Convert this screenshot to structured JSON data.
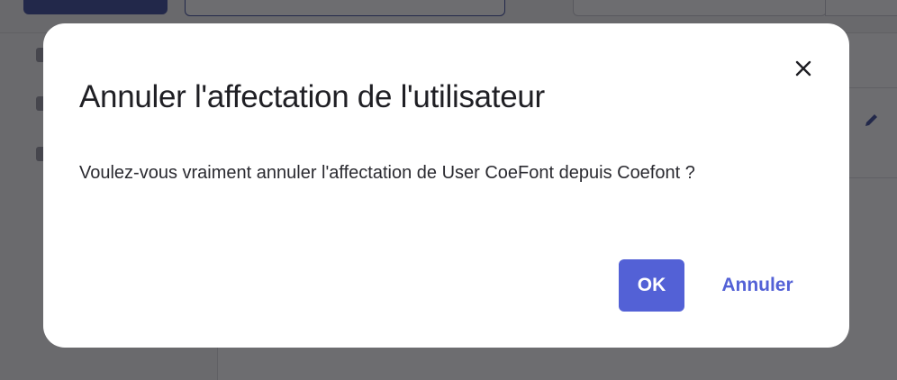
{
  "dialog": {
    "title": "Annuler l'affectation de l'utilisateur",
    "message": "Voulez-vous vraiment annuler l'affectation de User CoeFont depuis Coefont ?",
    "ok_label": "OK",
    "cancel_label": "Annuler",
    "close_icon": "close-icon"
  },
  "colors": {
    "accent": "#5361d6",
    "overlay": "rgba(20, 20, 24, 0.62)",
    "title_text": "#1f1f24"
  },
  "icons": {
    "background_edit": "pencil-icon"
  }
}
